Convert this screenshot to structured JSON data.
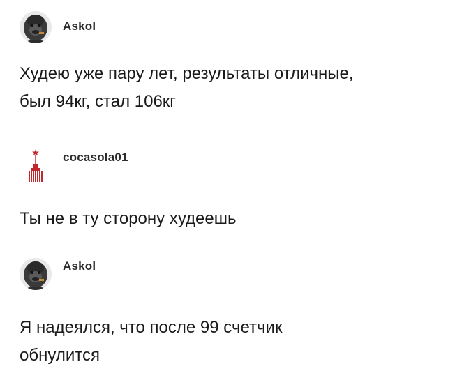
{
  "posts": [
    {
      "username": "Askol",
      "avatar_icon": "gorilla-avatar-icon",
      "text": "Худею уже пару лет, результаты отличные,\nбыл 94кг, стал 106кг"
    },
    {
      "username": "cocasola01",
      "avatar_icon": "red-tower-avatar-icon",
      "text": "Ты не в ту сторону худеешь"
    },
    {
      "username": "Askol",
      "avatar_icon": "gorilla-avatar-icon",
      "text": "Я надеялся, что после 99 счетчик\nобнулится"
    }
  ],
  "colors": {
    "text": "#1a1a1a",
    "username": "#2b2b2b",
    "background": "#ffffff",
    "tower_red": "#c1272d"
  }
}
